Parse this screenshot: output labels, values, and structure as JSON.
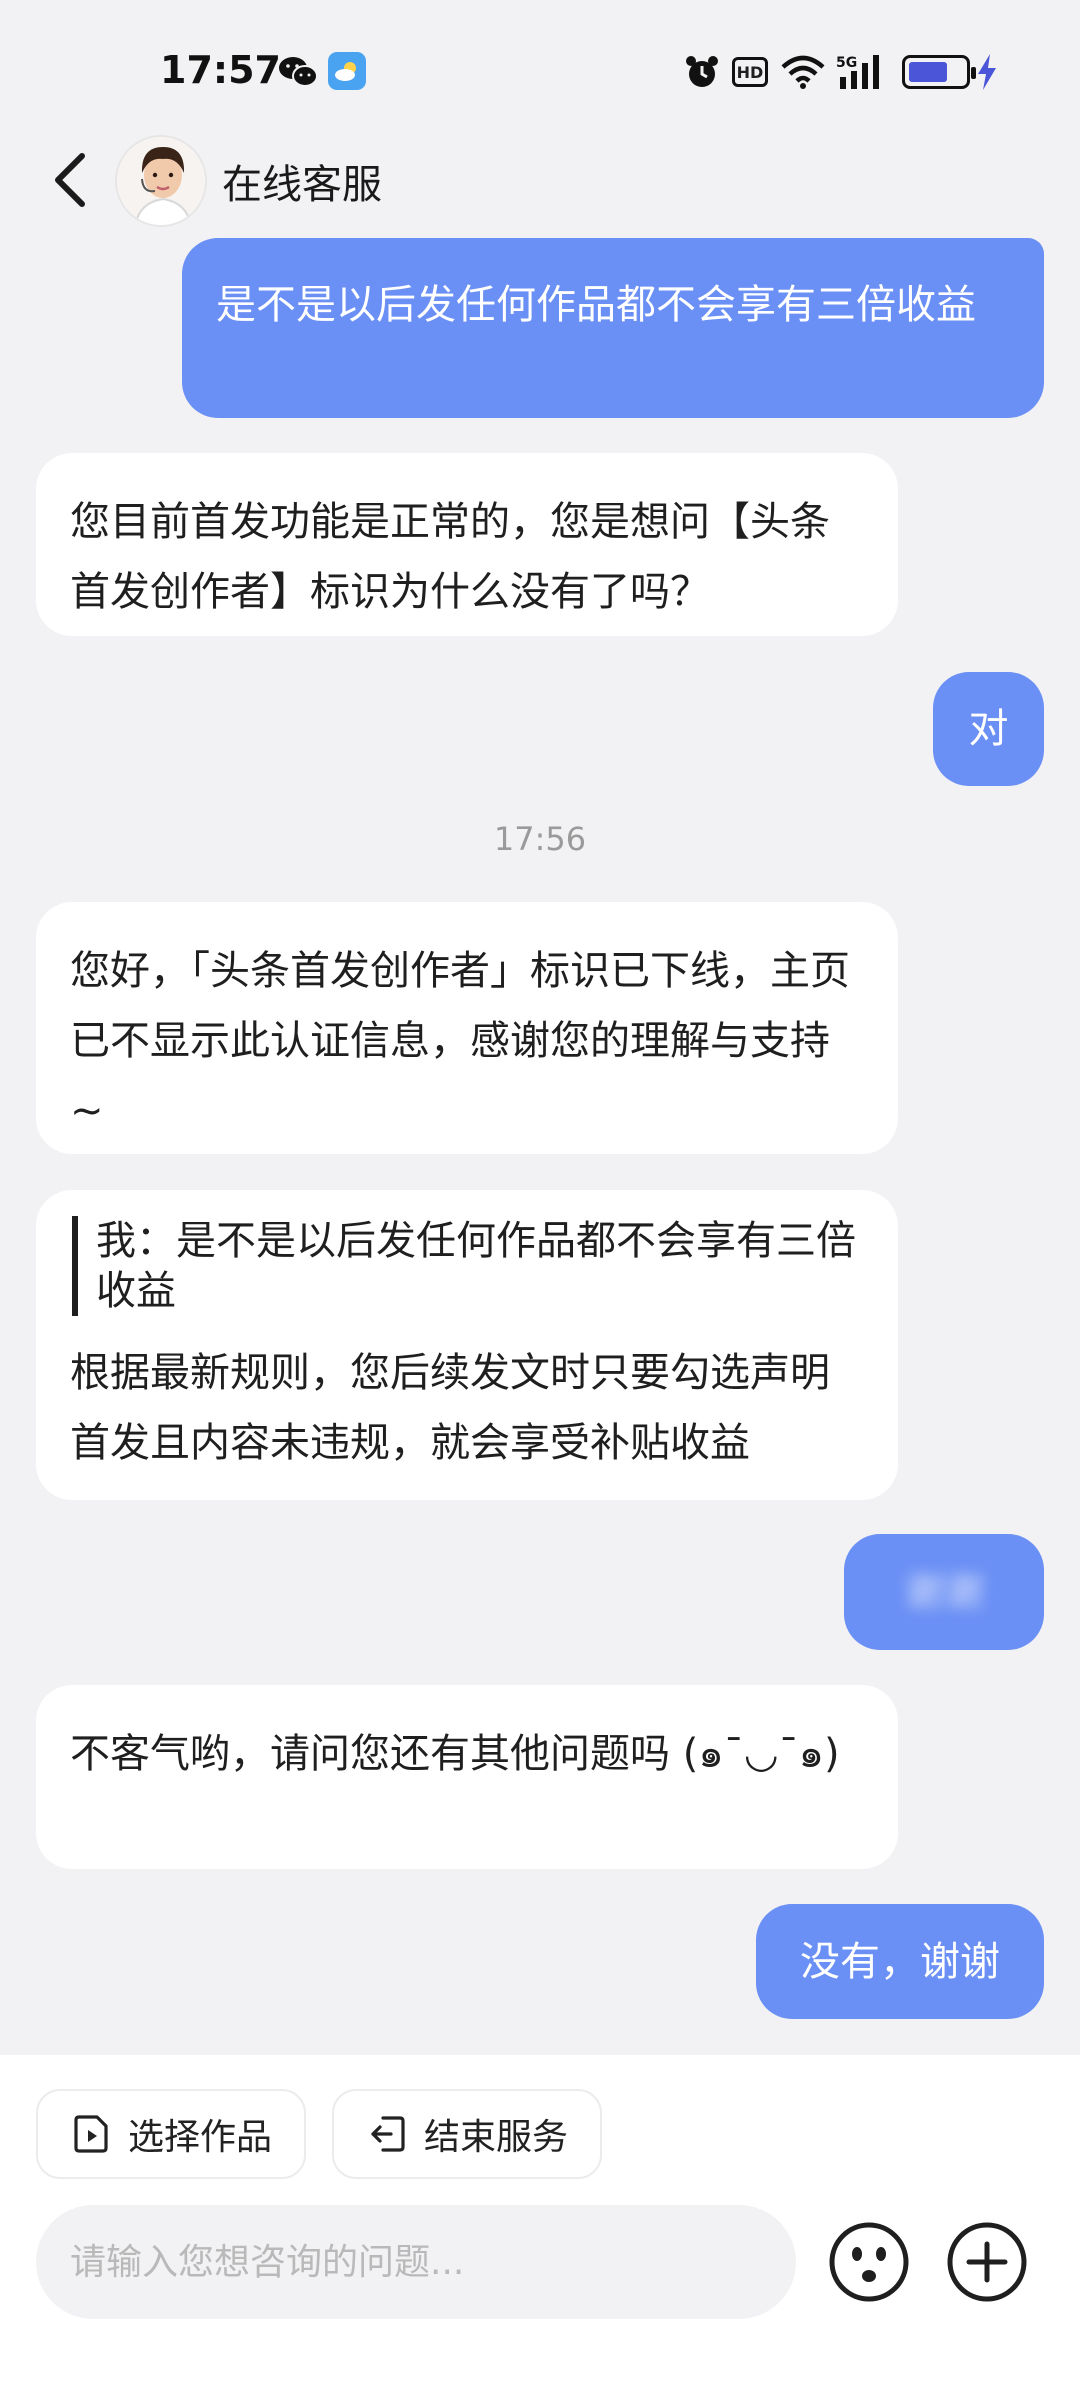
{
  "status_bar": {
    "time": "17:57",
    "hd": "HD",
    "network": "5G",
    "battery_level": 0.7,
    "icons": [
      "wechat-icon",
      "weather-icon",
      "alarm-icon",
      "hd-icon",
      "wifi-icon",
      "signal-icon",
      "battery-icon",
      "charging-bolt-icon"
    ]
  },
  "header": {
    "title": "在线客服",
    "back_icon": "chevron-left-icon",
    "avatar": "agent-avatar"
  },
  "messages": [
    {
      "from": "user",
      "text": "是不是以后发任何作品都不会享有三倍收益"
    },
    {
      "from": "agent",
      "text": "您目前首发功能是正常的，您是想问【头条首发创作者】标识为什么没有了吗？"
    },
    {
      "from": "user",
      "text": "对"
    },
    {
      "from": "agent",
      "text": "您好，「头条首发创作者」标识已下线，主页已不显示此认证信息，感谢您的理解与支持 ~"
    },
    {
      "from": "agent",
      "quote": "我：是不是以后发任何作品都不会享有三倍收益",
      "text": "根据最新规则，您后续发文时只要勾选声明首发且内容未违规，就会享受补贴收益"
    },
    {
      "from": "user",
      "text": "谢谢",
      "blurred": true
    },
    {
      "from": "agent",
      "text": "不客气哟，请问您还有其他问题吗 (๑¯◡¯๑)"
    },
    {
      "from": "user",
      "text": "没有，谢谢"
    }
  ],
  "timestamp": "17:56",
  "bottom": {
    "select_work_label": "选择作品",
    "end_service_label": "结束服务",
    "input_placeholder": "请输入您想咨询的问题...",
    "emoji_icon": "emoji-icon",
    "add_icon": "plus-icon"
  },
  "colors": {
    "background": "#f2f2f4",
    "user_bubble": "#6a8ff5",
    "agent_bubble": "#ffffff",
    "battery_fill": "#4b55d8"
  }
}
